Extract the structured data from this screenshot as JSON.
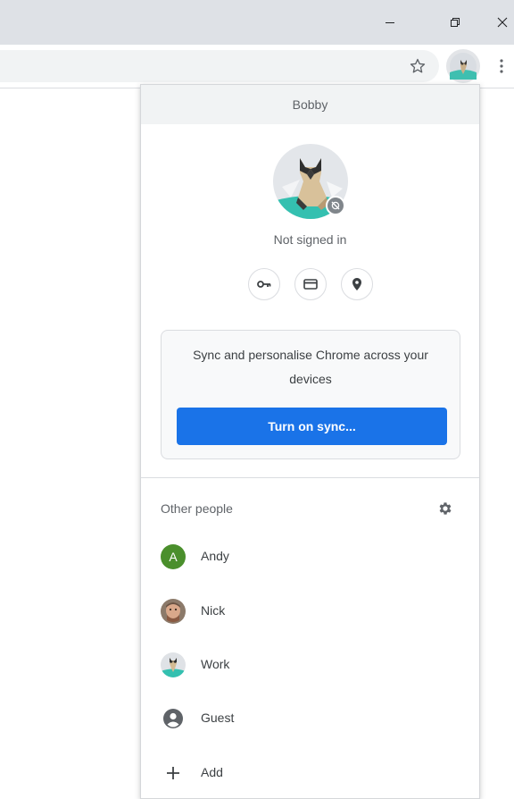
{
  "window": {
    "controls": [
      "minimize-icon",
      "restore-icon",
      "close-icon"
    ]
  },
  "toolbar": {
    "icons": [
      "star-icon",
      "profile-avatar-icon",
      "more-vert-icon"
    ]
  },
  "profile_menu": {
    "profile_name": "Bobby",
    "status": "Not signed in",
    "quick_icons": [
      "key-icon",
      "credit-card-icon",
      "location-pin-icon"
    ],
    "sync_message": "Sync and personalise Chrome across your devices",
    "sync_button": "Turn on sync...",
    "other_people_label": "Other people",
    "settings_icon": "gear-icon",
    "people": [
      {
        "name": "Andy",
        "avatar": "A",
        "color": "#4a8f2c"
      },
      {
        "name": "Nick",
        "avatar": "photo-avatar"
      },
      {
        "name": "Work",
        "avatar": "cat-avatar"
      },
      {
        "name": "Guest",
        "avatar": "guest-icon"
      },
      {
        "name": "Add",
        "avatar": "plus-icon"
      }
    ]
  },
  "colors": {
    "accent": "#1a73e8",
    "titlebar": "#dee1e6",
    "header": "#f1f3f4"
  }
}
